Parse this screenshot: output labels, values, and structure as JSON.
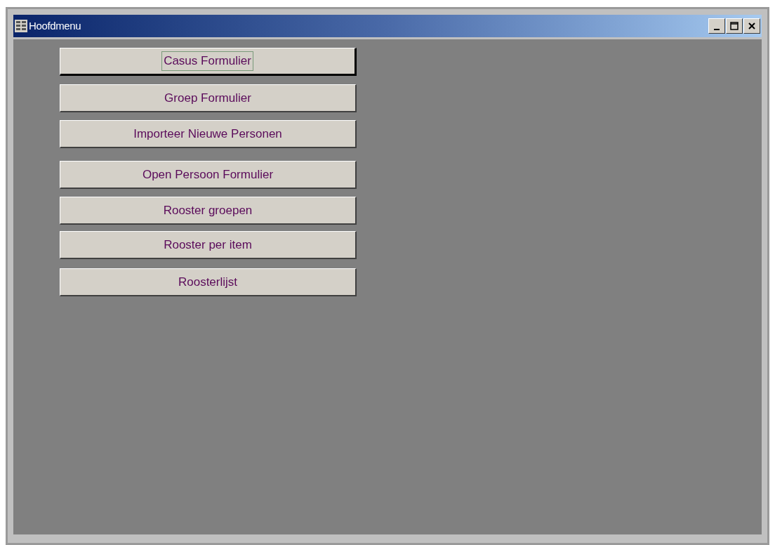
{
  "window": {
    "title": "Hoofdmenu"
  },
  "buttons": [
    {
      "label": "Casus Formulier",
      "selected": true
    },
    {
      "label": "Groep Formulier",
      "selected": false
    },
    {
      "label": "Importeer Nieuwe Personen",
      "selected": false
    },
    {
      "label": "Open Persoon Formulier",
      "selected": false
    },
    {
      "label": "Rooster groepen",
      "selected": false
    },
    {
      "label": "Rooster per item",
      "selected": false
    },
    {
      "label": "Roosterlijst",
      "selected": false
    }
  ]
}
